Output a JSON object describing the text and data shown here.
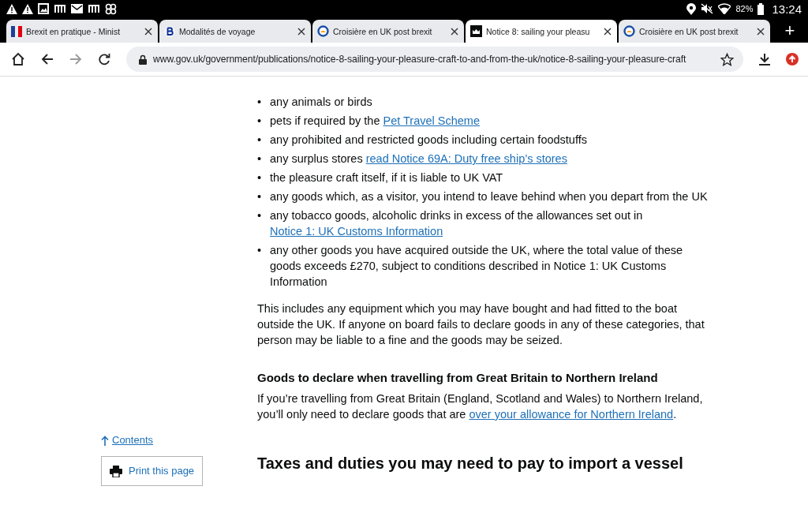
{
  "status_bar": {
    "battery": "82%",
    "time": "13:24"
  },
  "tabs": [
    {
      "title": "Brexit en pratique - Minist",
      "selected": false
    },
    {
      "title": "Modalités de voyage",
      "selected": false
    },
    {
      "title": "Croisière en UK post brexit",
      "selected": false
    },
    {
      "title": "Notice 8: sailing your pleasu",
      "selected": true
    },
    {
      "title": "Croisière en UK post brexit",
      "selected": false
    }
  ],
  "new_tab": "+",
  "address_bar": {
    "url": "www.gov.uk/government/publications/notice-8-sailing-your-pleasure-craft-to-and-from-the-uk/notice-8-sailing-your-pleasure-craft"
  },
  "sidebar": {
    "contents_link": "Contents",
    "print_button": "Print this page"
  },
  "bullets": [
    {
      "marker": "•",
      "parts": [
        {
          "kind": "text",
          "text": "any animals or birds"
        }
      ]
    },
    {
      "marker": "•",
      "parts": [
        {
          "kind": "text",
          "text": "pets if required by the "
        },
        {
          "kind": "link",
          "text": "Pet Travel Scheme"
        }
      ]
    },
    {
      "marker": "•",
      "parts": [
        {
          "kind": "text",
          "text": "any prohibited and restricted goods including certain foodstuffs"
        }
      ]
    },
    {
      "marker": "•",
      "parts": [
        {
          "kind": "text",
          "text": "any surplus stores "
        },
        {
          "kind": "link",
          "text": "read Notice 69A: Duty free ship’s stores"
        }
      ]
    },
    {
      "marker": "•",
      "parts": [
        {
          "kind": "text",
          "text": "the pleasure craft itself, if it is liable to UK VAT"
        }
      ]
    },
    {
      "marker": "•",
      "parts": [
        {
          "kind": "text",
          "text": "any goods which, as a visitor, you intend to leave behind when you depart from the UK"
        }
      ]
    },
    {
      "marker": "•",
      "parts": [
        {
          "kind": "text",
          "text": "any tobacco goods, alcoholic drinks in excess of the allowances set out in "
        },
        {
          "kind": "link",
          "text": "Notice 1: UK Customs Information"
        }
      ]
    },
    {
      "marker": "•",
      "parts": [
        {
          "kind": "text",
          "text": "any other goods you have acquired outside the UK, where the total value of these goods exceeds £270, subject to conditions described in Notice 1: UK Customs Information"
        }
      ]
    }
  ],
  "paragraph_1": "This includes any equipment which you may have bought and had fitted to the boat outside the UK. If anyone on board fails to declare goods in any of these categories, that person may be liable to a fine and the goods may be seized.",
  "subheading": "Goods to declare when travelling from Great Britain to Northern Ireland",
  "paragraph_2": [
    {
      "kind": "text",
      "text": "If you’re travelling from Great Britain (England, Scotland and Wales) to Northern Ireland, you’ll only need to declare goods that are "
    },
    {
      "kind": "link",
      "text": "over your allowance for Northern Ireland"
    },
    {
      "kind": "text",
      "text": "."
    }
  ],
  "heading": "Taxes and duties you may need to pay to import a vessel"
}
